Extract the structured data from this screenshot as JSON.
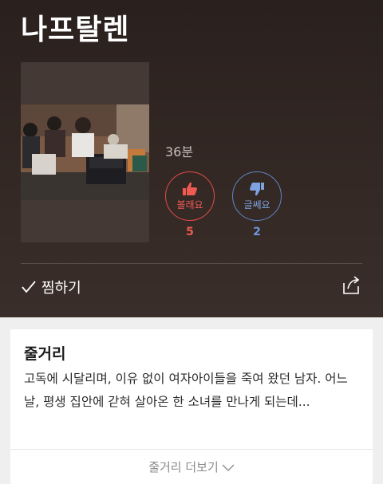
{
  "title": "나프탈렌",
  "duration": "36분",
  "votes": {
    "like": {
      "label": "볼래요",
      "count": "5",
      "icon": "thumbs-up-icon",
      "color": "#e24d48"
    },
    "dislike": {
      "label": "글쎄요",
      "count": "2",
      "icon": "thumbs-down-icon",
      "color": "#5f86c8"
    }
  },
  "actions": {
    "wish_label": "찜하기",
    "share_icon": "share-icon"
  },
  "synopsis": {
    "heading": "줄거리",
    "text": "고독에 시달리며, 이유 없이 여자아이들을 죽여 왔던 남자. 어느 날, 평생 집안에 갇혀 살아온 한 소녀를 만나게 되는데...",
    "more_label": "줄거리 더보기"
  }
}
